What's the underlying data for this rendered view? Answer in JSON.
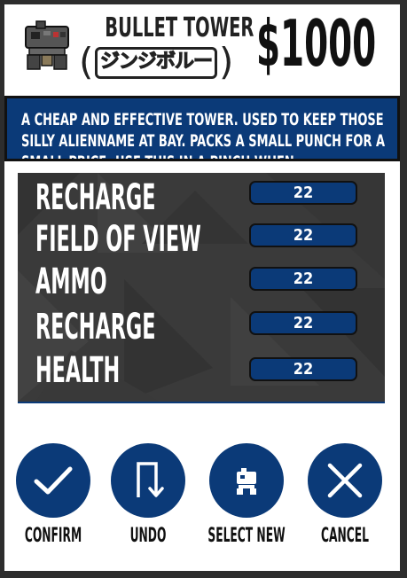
{
  "tower": {
    "name": "BULLET TOWER",
    "subtitle": "ジンジボルー",
    "price": "$1000",
    "icon": "robot-turret-icon"
  },
  "description": "A CHEAP AND EFFECTIVE TOWER. USED TO KEEP THOSE SILLY ALIENNAME AT BAY. PACKS A SMALL PUNCH FOR A SMALL PRICE..USE THIS IN A PINCH WHEN",
  "stats": [
    {
      "label": "RECHARGE",
      "value": "22"
    },
    {
      "label": "FIELD OF VIEW",
      "value": "22"
    },
    {
      "label": "AMMO",
      "value": "22"
    },
    {
      "label": "RECHARGE",
      "value": "22"
    },
    {
      "label": "HEALTH",
      "value": "22"
    }
  ],
  "actions": [
    {
      "label": "CONFIRM",
      "icon": "checkmark-icon"
    },
    {
      "label": "UNDO",
      "icon": "undo-arrow-icon"
    },
    {
      "label": "SELECT NEW",
      "icon": "tower-select-icon"
    },
    {
      "label": "CANCEL",
      "icon": "close-icon"
    }
  ],
  "colors": {
    "accent": "#0b3a78",
    "panel": "#3a3a3a",
    "frame": "#2d2d2d",
    "card": "#ffffff"
  }
}
